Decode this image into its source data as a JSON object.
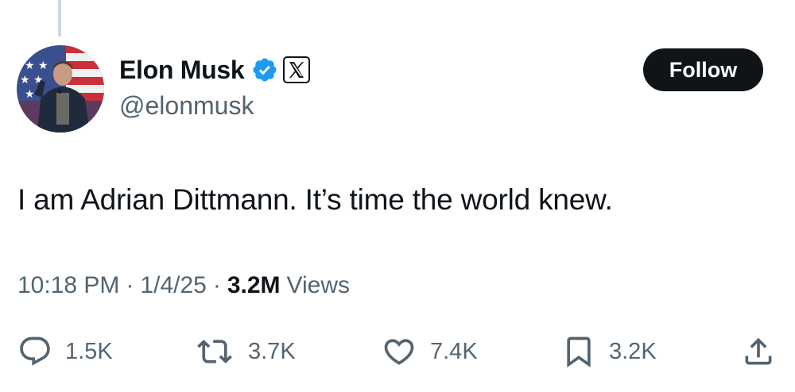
{
  "author": {
    "display_name": "Elon Musk",
    "handle": "@elonmusk",
    "avatar_icon": "avatar-photo",
    "verified_color": "#1d9bf0"
  },
  "follow_button": {
    "label": "Follow"
  },
  "tweet": {
    "text": "I am Adrian Dittmann. It’s time the world knew.",
    "time": "10:18 PM",
    "separator": "·",
    "date": "1/4/25",
    "views_count": "3.2M",
    "views_label": "Views"
  },
  "actions": {
    "replies": {
      "icon": "reply-icon",
      "count": "1.5K"
    },
    "reposts": {
      "icon": "repost-icon",
      "count": "3.7K"
    },
    "likes": {
      "icon": "heart-icon",
      "count": "7.4K"
    },
    "bookmarks": {
      "icon": "bookmark-icon",
      "count": "3.2K"
    },
    "share": {
      "icon": "share-icon"
    }
  },
  "colors": {
    "text_primary": "#0f1419",
    "text_secondary": "#536471",
    "thread_line": "#cfd9de",
    "button_bg": "#0f1419"
  }
}
